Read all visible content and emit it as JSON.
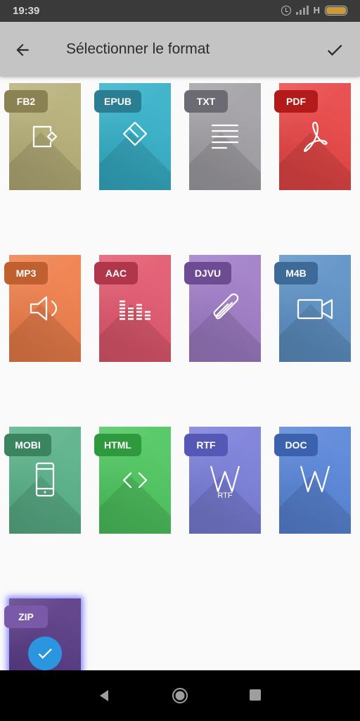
{
  "status_bar": {
    "time": "19:39",
    "network": "H"
  },
  "app_bar": {
    "title": "Sélectionner le format"
  },
  "formats": [
    {
      "label": "FB2",
      "color": "#b7b07a",
      "badge_color": "#8a8252",
      "icon": "fb2-icon"
    },
    {
      "label": "EPUB",
      "color": "#37b0c8",
      "badge_color": "#2b7e92",
      "icon": "epub-icon"
    },
    {
      "label": "TXT",
      "color": "#a3a1a6",
      "badge_color": "#6c6a72",
      "icon": "text-lines-icon"
    },
    {
      "label": "PDF",
      "color": "#e84747",
      "badge_color": "#b31b1b",
      "icon": "acrobat-icon"
    },
    {
      "label": "MP3",
      "color": "#ef7f4c",
      "badge_color": "#c05f30",
      "icon": "speaker-icon"
    },
    {
      "label": "AAC",
      "color": "#e2596f",
      "badge_color": "#b0364a",
      "icon": "equalizer-icon"
    },
    {
      "label": "DJVU",
      "color": "#a07dc7",
      "badge_color": "#6e4c94",
      "icon": "paperclip-icon"
    },
    {
      "label": "M4B",
      "color": "#5f92c6",
      "badge_color": "#3d6a98",
      "icon": "video-camera-icon"
    },
    {
      "label": "MOBI",
      "color": "#5bb28a",
      "badge_color": "#3a8460",
      "icon": "phone-icon"
    },
    {
      "label": "HTML",
      "color": "#4fc660",
      "badge_color": "#2e9a3d",
      "icon": "code-brackets-icon"
    },
    {
      "label": "RTF",
      "color": "#7b7fd9",
      "badge_color": "#5558b4",
      "icon": "word-w-icon",
      "sublabel": "RTF"
    },
    {
      "label": "DOC",
      "color": "#5a86d8",
      "badge_color": "#3a62ad",
      "icon": "word-w-icon"
    },
    {
      "label": "ZIP",
      "color": "#5a3c86",
      "badge_color": "#7a5aa8",
      "icon": "check-icon",
      "selected": true
    }
  ]
}
